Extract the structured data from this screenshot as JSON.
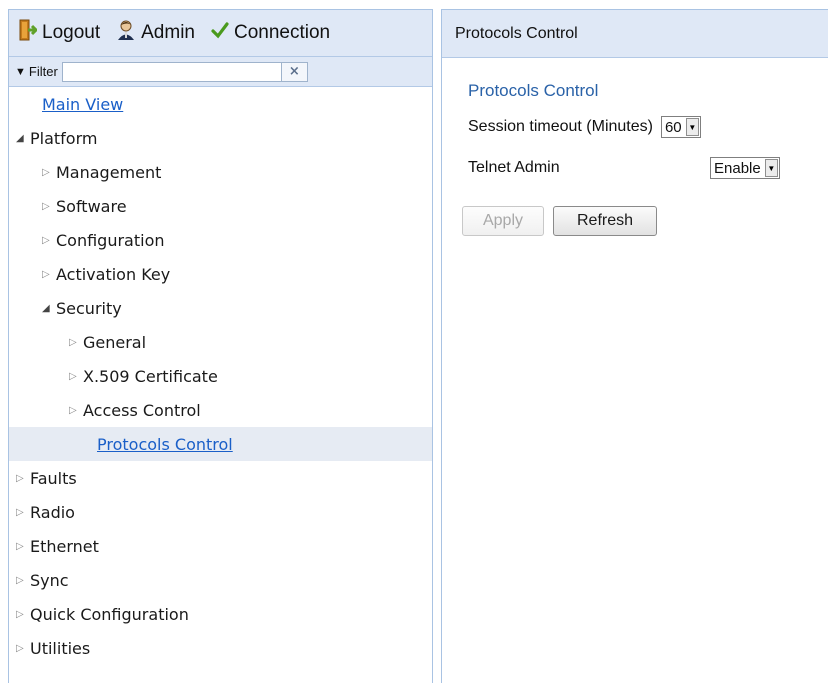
{
  "toolbar": {
    "logout_label": "Logout",
    "admin_label": "Admin",
    "connection_label": "Connection",
    "icons": {
      "logout": "logout-door-icon",
      "admin": "admin-user-icon",
      "connection": "checkmark-icon"
    },
    "connection_color": "#4a9a1e"
  },
  "filter": {
    "label": "Filter",
    "value": "",
    "clear_symbol": "×"
  },
  "tree": {
    "main_view": "Main View",
    "platform": "Platform",
    "management": "Management",
    "software": "Software",
    "configuration": "Configuration",
    "activation_key": "Activation Key",
    "security": "Security",
    "general": "General",
    "x509": "X.509 Certificate",
    "access_control": "Access Control",
    "protocols_control": "Protocols Control",
    "faults": "Faults",
    "radio": "Radio",
    "ethernet": "Ethernet",
    "sync": "Sync",
    "quick_configuration": "Quick Configuration",
    "utilities": "Utilities"
  },
  "panel": {
    "header": "Protocols Control",
    "section_title": "Protocols Control",
    "session_timeout_label": "Session timeout (Minutes)",
    "session_timeout_value": "60",
    "telnet_label": "Telnet Admin",
    "telnet_value": "Enable",
    "apply_label": "Apply",
    "refresh_label": "Refresh"
  },
  "colors": {
    "header_bg": "#dfe8f6",
    "link": "#1a5fc8",
    "section_title": "#2a62a8",
    "selected_row": "#e6ebf3"
  }
}
